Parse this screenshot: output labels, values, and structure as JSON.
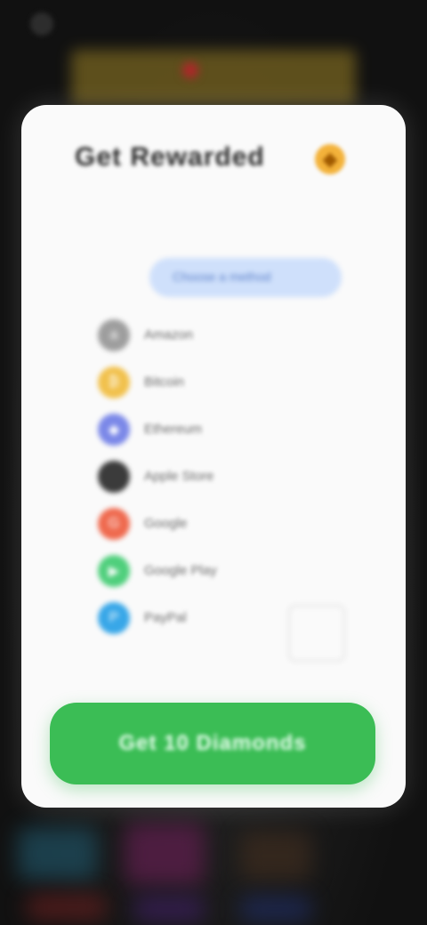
{
  "header": {
    "title": "Get Rewarded"
  },
  "search": {
    "label": "Choose a method"
  },
  "methods": [
    {
      "label": "Amazon",
      "icon": "amazon-icon",
      "color": "#9e9e9e",
      "glyph": "a"
    },
    {
      "label": "Bitcoin",
      "icon": "bitcoin-icon",
      "color": "#f1c14d",
      "glyph": "₿"
    },
    {
      "label": "Ethereum",
      "icon": "ethereum-icon",
      "color": "#7b88e8",
      "glyph": "◆"
    },
    {
      "label": "Apple Store",
      "icon": "apple-icon",
      "color": "#3b3b3b",
      "glyph": ""
    },
    {
      "label": "Google",
      "icon": "google-icon",
      "color": "#ef6a4f",
      "glyph": "G"
    },
    {
      "label": "Google Play",
      "icon": "google-play-icon",
      "color": "#4fcf7c",
      "glyph": "▶"
    },
    {
      "label": "PayPal",
      "icon": "paypal-icon",
      "color": "#38a7e8",
      "glyph": "P"
    }
  ],
  "cta": {
    "label": "Get 10 Diamonds"
  },
  "colors": {
    "accent": "#3bbd55",
    "background": "#141414",
    "card": "#fafafa"
  }
}
